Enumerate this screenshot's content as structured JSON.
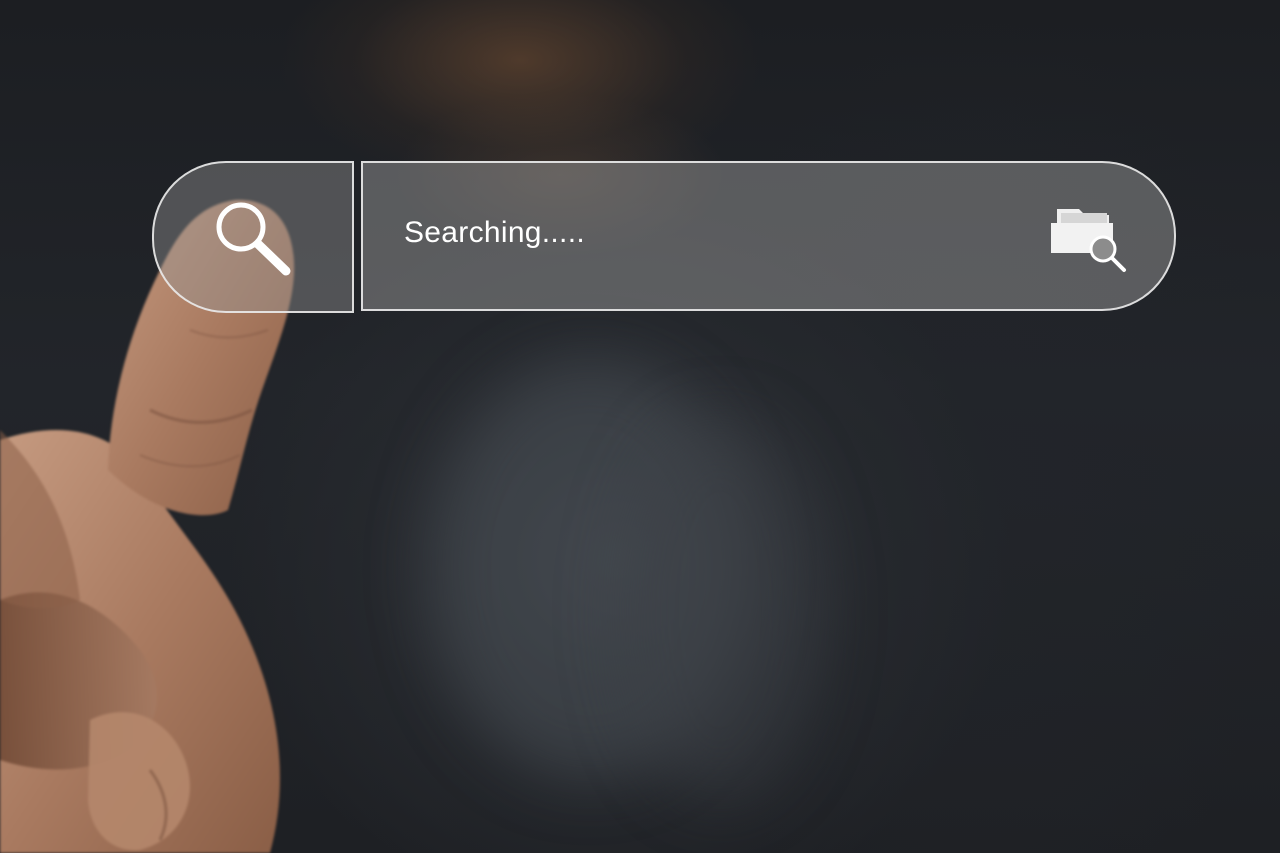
{
  "search": {
    "value": "Searching.....",
    "search_icon": "search-icon",
    "folder_icon": "folder-search-icon"
  },
  "colors": {
    "background": "#1b1d21",
    "bar_border": "#ebebeb",
    "bar_fill": "#8c8c8c",
    "text": "#ffffff"
  }
}
